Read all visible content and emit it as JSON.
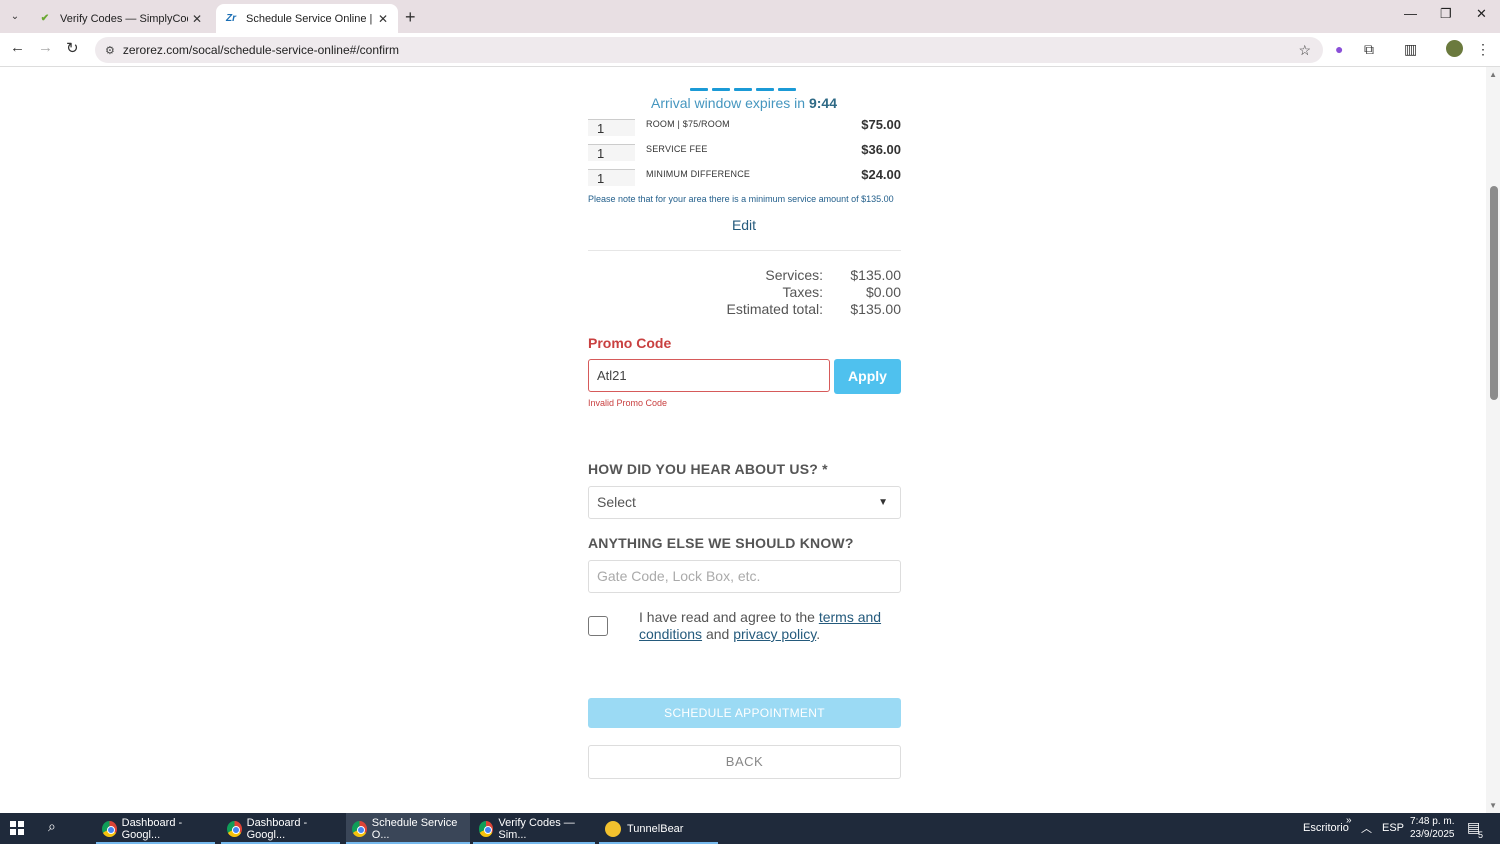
{
  "browser": {
    "tabs": [
      {
        "title": "Verify Codes — SimplyCodes",
        "active": false
      },
      {
        "title": "Schedule Service Online | SoCal",
        "active": true
      }
    ],
    "url": "zerorez.com/socal/schedule-service-online#/confirm"
  },
  "page": {
    "expires_text": "Arrival window expires in",
    "expires_time": "9:44",
    "line_items": [
      {
        "qty": "1",
        "name": "ROOM | $75/ROOM",
        "price": "$75.00"
      },
      {
        "qty": "1",
        "name": "SERVICE FEE",
        "price": "$36.00"
      },
      {
        "qty": "1",
        "name": "MINIMUM DIFFERENCE",
        "price": "$24.00"
      }
    ],
    "minimum_note": "Please note that for your area there is a minimum service amount of $135.00",
    "edit_label": "Edit",
    "summary": {
      "services_label": "Services:",
      "services_value": "$135.00",
      "taxes_label": "Taxes:",
      "taxes_value": "$0.00",
      "total_label": "Estimated total:",
      "total_value": "$135.00"
    },
    "promo": {
      "label": "Promo Code",
      "value": "Atl21",
      "apply_label": "Apply",
      "error": "Invalid Promo Code"
    },
    "hear_about": {
      "label": "HOW DID YOU HEAR ABOUT US? *",
      "selected": "Select"
    },
    "anything_else": {
      "label": "ANYTHING ELSE WE SHOULD KNOW?",
      "placeholder": "Gate Code, Lock Box, etc."
    },
    "agree": {
      "prefix": "I have read and agree to the",
      "terms_link": "terms and conditions",
      "middle": "and",
      "privacy_link": "privacy policy",
      "suffix": "."
    },
    "schedule_label": "SCHEDULE APPOINTMENT",
    "back_label": "BACK"
  },
  "taskbar": {
    "items": [
      {
        "label": "Dashboard - Googl...",
        "active": false
      },
      {
        "label": "Dashboard - Googl...",
        "active": false
      },
      {
        "label": "Schedule Service O...",
        "active": true
      },
      {
        "label": "Verify Codes — Sim...",
        "active": false
      },
      {
        "label": "TunnelBear",
        "active": false
      }
    ],
    "desktop_label": "Escritorio",
    "language": "ESP",
    "time": "7:48 p. m.",
    "date": "23/9/2025",
    "notifications": "5"
  },
  "colors": {
    "accent": "#4fc1ee",
    "error": "#c94040",
    "link": "#245a7c"
  }
}
